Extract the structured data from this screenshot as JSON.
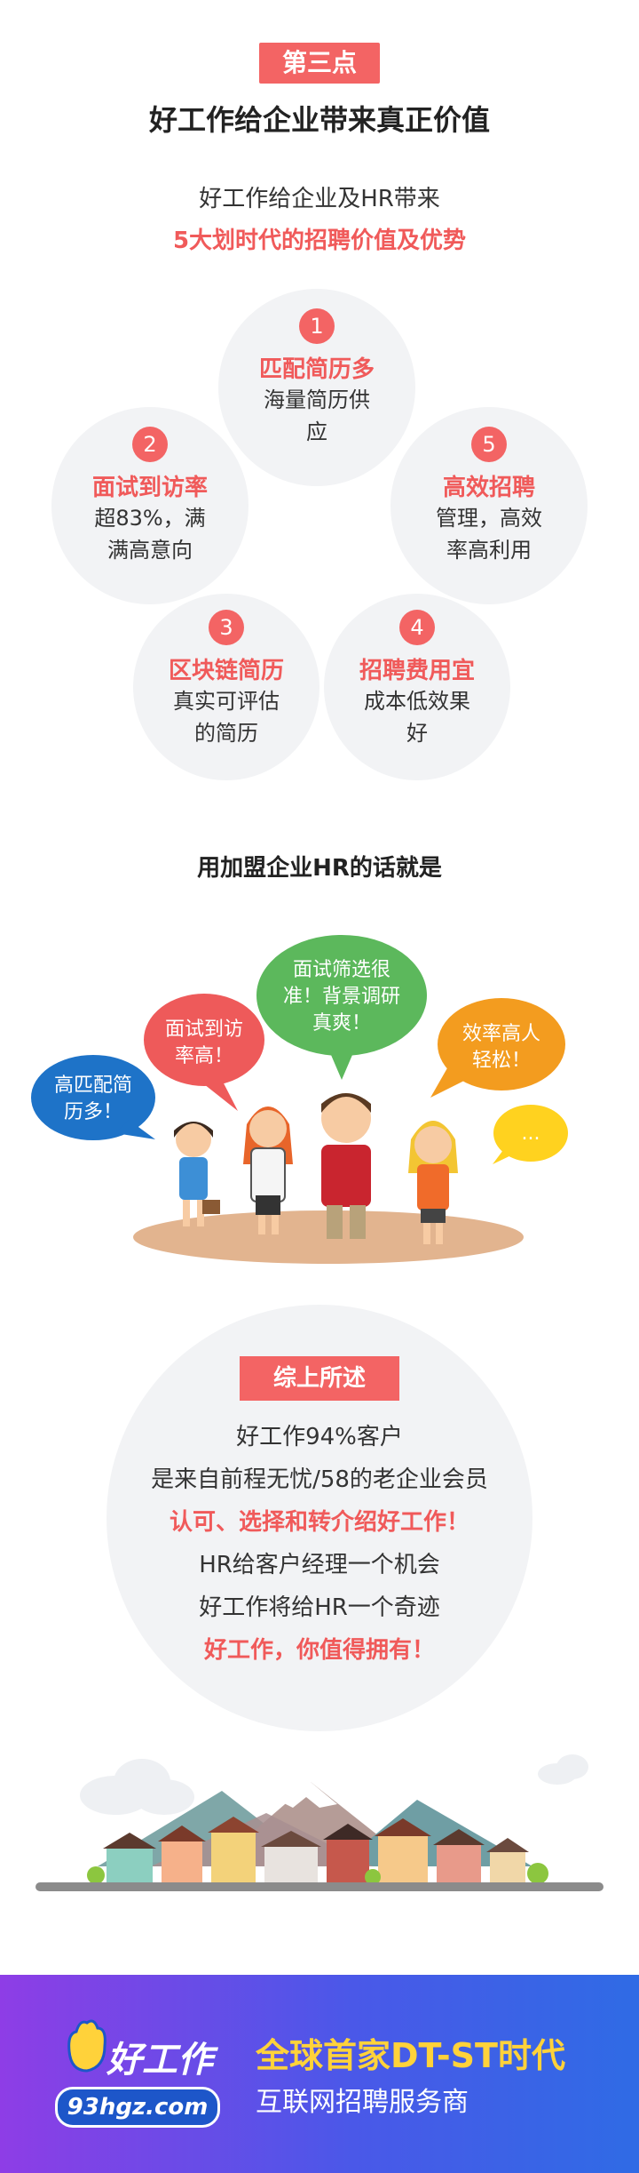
{
  "section": {
    "tag": "第三点",
    "title": "好工作给企业带来真正价值",
    "intro_line1": "好工作给企业及HR带来",
    "intro_line2": "5大划时代的招聘价值及优势"
  },
  "values": [
    {
      "number": "1",
      "title": "匹配简历多",
      "line1": "海量简历供",
      "line2": "应"
    },
    {
      "number": "2",
      "title": "面试到访率",
      "line1": "超83%，满",
      "line2": "满高意向"
    },
    {
      "number": "5",
      "title": "高效招聘",
      "line1": "管理，高效",
      "line2": "率高利用"
    },
    {
      "number": "3",
      "title": "区块链简历",
      "line1": "真实可评估",
      "line2": "的简历"
    },
    {
      "number": "4",
      "title": "招聘费用宜",
      "line1": "成本低效果",
      "line2": "好"
    }
  ],
  "hr_section": {
    "heading": "用加盟企业HR的话就是",
    "bubbles": [
      {
        "line1": "高匹配简",
        "line2": "历多！",
        "color": "#1e73c8"
      },
      {
        "line1": "面试到访",
        "line2": "率高！",
        "color": "#ee5a5a"
      },
      {
        "line1": "面试筛选很",
        "line2": "准！背景调研",
        "line3": "真爽！",
        "color": "#5cb85c"
      },
      {
        "line1": "效率高人",
        "line2": "轻松！",
        "color": "#f39c1f"
      },
      {
        "line1": "...",
        "color": "#ffd21f"
      }
    ]
  },
  "summary": {
    "tag": "综上所述",
    "line1": "好工作94%客户",
    "line2": "是来自前程无忧/58的老企业会员",
    "line3": "认可、选择和转介绍好工作！",
    "line4": "HR给客户经理一个机会",
    "line5": "好工作将给HR一个奇迹",
    "line6": "好工作，你值得拥有！"
  },
  "footer": {
    "logo_name": "好工作",
    "logo_url": "93hgz.com",
    "slogan1": "全球首家DT-ST时代",
    "slogan2": "互联网招聘服务商"
  },
  "colors": {
    "accent_red": "#f36464",
    "bubble_gray": "#f2f3f5",
    "footer_purple": "#8e3de6",
    "footer_blue": "#2f6be5",
    "slogan_yellow": "#ffd23a"
  }
}
